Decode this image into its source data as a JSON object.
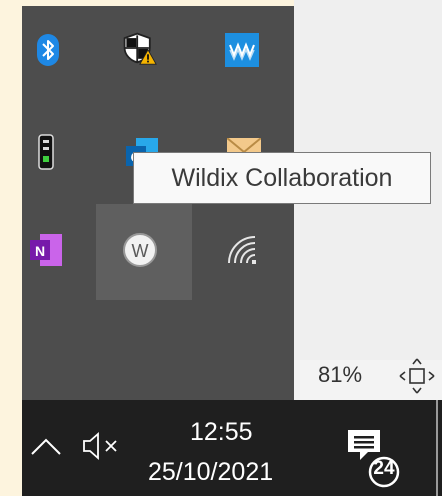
{
  "tooltip": {
    "text": "Wildix Collaboration"
  },
  "tray_icons": [
    {
      "name": "bluetooth-icon"
    },
    {
      "name": "windows-security-warning-icon"
    },
    {
      "name": "waves-audio-icon"
    },
    {
      "name": "traffic-light-icon"
    },
    {
      "name": "outlook-icon"
    },
    {
      "name": "mail-icon"
    },
    {
      "name": "onenote-icon"
    },
    {
      "name": "wildix-collaboration-icon"
    },
    {
      "name": "wifi-icon"
    }
  ],
  "statusbar": {
    "zoom": "81%"
  },
  "taskbar": {
    "time": "12:55",
    "date": "25/10/2021",
    "notification_count": "24"
  },
  "colors": {
    "tray_bg": "#4d4d4d",
    "taskbar_bg": "#1f1f1f",
    "bluetooth": "#2196f3",
    "onenote": "#7b2fbe"
  }
}
